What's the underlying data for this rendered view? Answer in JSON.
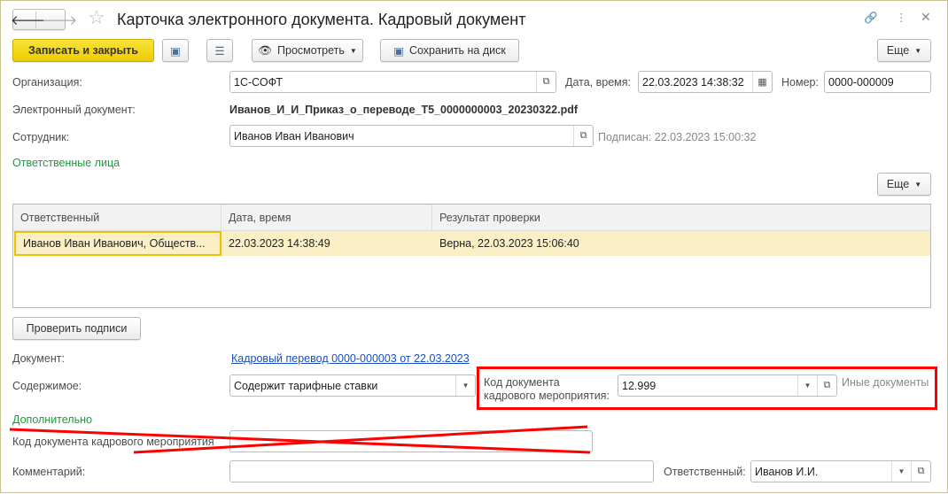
{
  "title": "Карточка электронного документа. Кадровый документ",
  "toolbar": {
    "save_close": "Записать и закрыть",
    "preview": "Просмотреть",
    "save_disk": "Сохранить на диск",
    "more": "Еще"
  },
  "fields": {
    "org_label": "Организация:",
    "org_value": "1С-СОФТ",
    "date_label": "Дата, время:",
    "date_value": "22.03.2023 14:38:32",
    "num_label": "Номер:",
    "num_value": "0000-000009",
    "edoc_label": "Электронный документ:",
    "edoc_value": "Иванов_И_И_Приказ_о_переводе_Т5_0000000003_20230322.pdf",
    "emp_label": "Сотрудник:",
    "emp_value": "Иванов Иван Иванович",
    "signed": "Подписан: 22.03.2023 15:00:32"
  },
  "responsible_section": "Ответственные лица",
  "table": {
    "more": "Еще",
    "headers": [
      "Ответственный",
      "Дата, время",
      "Результат проверки"
    ],
    "rows": [
      [
        "Иванов Иван Иванович, Обществ...",
        "22.03.2023 14:38:49",
        "Верна, 22.03.2023 15:06:40"
      ]
    ]
  },
  "check_sign": "Проверить подписи",
  "doc_label": "Документ:",
  "doc_link": "Кадровый перевод 0000-000003 от 22.03.2023",
  "content_label": "Содержимое:",
  "content_value": "Содержит тарифные ставки",
  "code_label_1": "Код документа",
  "code_label_2": "кадрового мероприятия:",
  "code_value": "12.999",
  "code_hint": "Иные документы",
  "extra_section": "Дополнительно",
  "code_old_label": "Код документа кадрового мероприятия",
  "comment_label": "Комментарий:",
  "resp_label": "Ответственный:",
  "resp_value": "Иванов И.И.",
  "colors": {
    "accent": "#f2d40c",
    "highlight": "#ff0000",
    "link": "#1a4fc4",
    "green": "#1d9a3c"
  }
}
